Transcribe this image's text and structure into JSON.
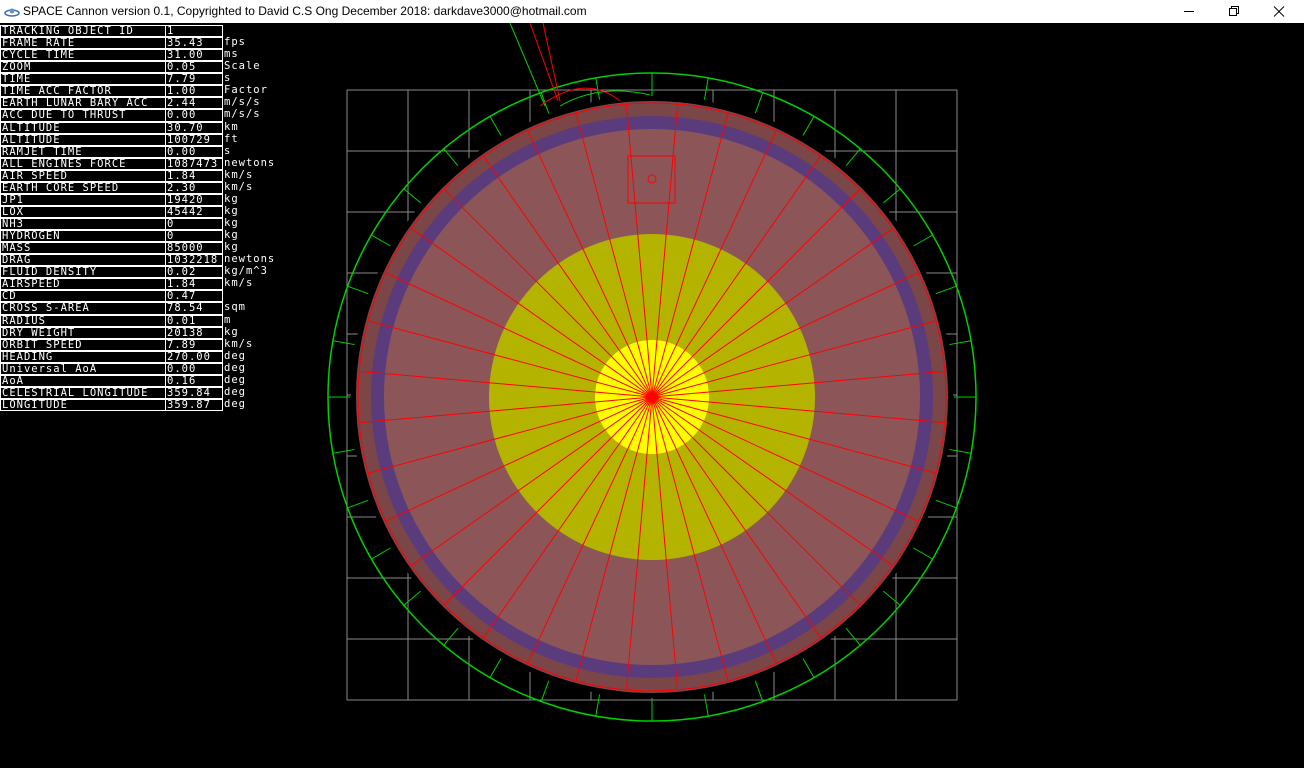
{
  "window": {
    "title": "SPACE Cannon version 0.1, Copyrighted to David C.S Ong  December 2018: darkdave3000@hotmail.com"
  },
  "stats": [
    {
      "label": "TRACKING OBJECT ID",
      "value": "1",
      "unit": ""
    },
    {
      "label": "FRAME RATE",
      "value": "35.43",
      "unit": "fps"
    },
    {
      "label": "CYCLE TIME",
      "value": "31.00",
      "unit": "ms"
    },
    {
      "label": "ZOOM",
      "value": "0.05",
      "unit": "Scale"
    },
    {
      "label": "TIME",
      "value": "7.79",
      "unit": "s"
    },
    {
      "label": "TIME ACC FACTOR",
      "value": "1.00",
      "unit": "Factor"
    },
    {
      "label": "EARTH LUNAR BARY ACC",
      "value": "2.44",
      "unit": "m/s/s"
    },
    {
      "label": "ACC DUE TO THRUST",
      "value": "0.00",
      "unit": "m/s/s"
    },
    {
      "label": "ALTITUDE",
      "value": "30.70",
      "unit": "km"
    },
    {
      "label": "ALTITUDE",
      "value": "100729",
      "unit": "ft"
    },
    {
      "label": "RAMJET TIME",
      "value": "0.00",
      "unit": "s"
    },
    {
      "label": "ALL ENGINES FORCE",
      "value": "1087473",
      "unit": "newtons"
    },
    {
      "label": "AIR SPEED",
      "value": "1.84",
      "unit": "km/s"
    },
    {
      "label": "EARTH CORE SPEED",
      "value": "2.30",
      "unit": "km/s"
    },
    {
      "label": "JP1",
      "value": "19420",
      "unit": "kg"
    },
    {
      "label": "LOX",
      "value": "45442",
      "unit": "kg"
    },
    {
      "label": "NH3",
      "value": "0",
      "unit": "kg"
    },
    {
      "label": "HYDROGEN",
      "value": "0",
      "unit": "kg"
    },
    {
      "label": "MASS",
      "value": "85000",
      "unit": "kg"
    },
    {
      "label": "DRAG",
      "value": "1032218",
      "unit": "newtons"
    },
    {
      "label": "FLUID DENSITY",
      "value": "0.02",
      "unit": "kg/m^3"
    },
    {
      "label": "AIRSPEED",
      "value": "1.84",
      "unit": "km/s"
    },
    {
      "label": "CD",
      "value": "0.47",
      "unit": ""
    },
    {
      "label": "CROSS S-AREA",
      "value": "78.54",
      "unit": "sqm"
    },
    {
      "label": "RADIUS",
      "value": "0.01",
      "unit": "m"
    },
    {
      "label": "DRY WEIGHT",
      "value": "20138",
      "unit": "kg"
    },
    {
      "label": "ORBIT SPEED",
      "value": "7.89",
      "unit": "km/s"
    },
    {
      "label": "HEADING",
      "value": "270.00",
      "unit": "deg"
    },
    {
      "label": "Universal AoA",
      "value": "0.00",
      "unit": "deg"
    },
    {
      "label": "AoA",
      "value": "0.16",
      "unit": "deg"
    },
    {
      "label": "CELESTRIAL LONGITUDE",
      "value": "359.84",
      "unit": "deg"
    },
    {
      "label": "LONGITUDE",
      "value": "359.87",
      "unit": "deg"
    }
  ],
  "colors": {
    "grid": "#8a8a8a",
    "orbit_ring": "#00d000",
    "radial_lines": "#ff0000",
    "crust": "#7a4648",
    "atmosphere_band": "#5a3c7c",
    "mantle": "#8c5658",
    "outer_core": "#b4b400",
    "inner_core": "#ffff00"
  }
}
